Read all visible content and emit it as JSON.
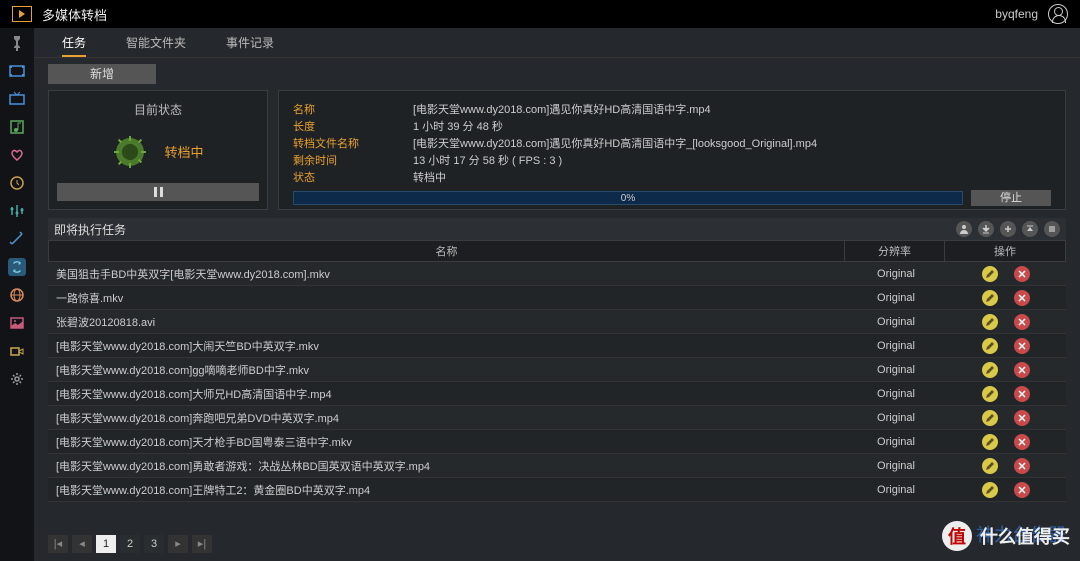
{
  "header": {
    "app_title": "多媒体转档",
    "username": "byqfeng"
  },
  "sidebar": {
    "icons": [
      "pin",
      "film",
      "tv",
      "music-lib",
      "heart",
      "clock",
      "equalizer",
      "wand",
      "recycle",
      "globe",
      "gallery",
      "camera",
      "settings"
    ],
    "active_index": 8
  },
  "tabs": {
    "items": [
      {
        "label": "任务",
        "active": true
      },
      {
        "label": "智能文件夹",
        "active": false
      },
      {
        "label": "事件记录",
        "active": false
      }
    ]
  },
  "buttons": {
    "new": "新增",
    "stop": "停止"
  },
  "status_panel": {
    "title": "目前状态",
    "status_text": "转档中"
  },
  "detail_panel": {
    "rows": [
      {
        "label": "名称",
        "value": "[电影天堂www.dy2018.com]遇见你真好HD高清国语中字.mp4"
      },
      {
        "label": "长度",
        "value": "1 小时 39 分 48 秒"
      },
      {
        "label": "转档文件名称",
        "value": "[电影天堂www.dy2018.com]遇见你真好HD高清国语中字_[looksgood_Original].mp4"
      },
      {
        "label": "剩余时间",
        "value": "13 小时 17 分 58 秒 ( FPS : 3 )"
      },
      {
        "label": "状态",
        "value": "转档中"
      }
    ],
    "progress_text": "0%"
  },
  "queue": {
    "title": "即将执行任务",
    "columns": {
      "name": "名称",
      "resolution": "分辨率",
      "operation": "操作"
    },
    "rows": [
      {
        "name": "美国狙击手BD中英双字[电影天堂www.dy2018.com].mkv",
        "res": "Original"
      },
      {
        "name": "一路惊喜.mkv",
        "res": "Original"
      },
      {
        "name": "张碧波20120818.avi",
        "res": "Original"
      },
      {
        "name": "[电影天堂www.dy2018.com]大闹天竺BD中英双字.mkv",
        "res": "Original"
      },
      {
        "name": "[电影天堂www.dy2018.com]gg嘀嘀老师BD中字.mkv",
        "res": "Original"
      },
      {
        "name": "[电影天堂www.dy2018.com]大师兄HD高清国语中字.mp4",
        "res": "Original"
      },
      {
        "name": "[电影天堂www.dy2018.com]奔跑吧兄弟DVD中英双字.mp4",
        "res": "Original"
      },
      {
        "name": "[电影天堂www.dy2018.com]天才枪手BD国粤泰三语中字.mkv",
        "res": "Original"
      },
      {
        "name": "[电影天堂www.dy2018.com]勇敢者游戏：决战丛林BD国英双语中英双字.mp4",
        "res": "Original"
      },
      {
        "name": "[电影天堂www.dy2018.com]王牌特工2：黄金圈BD中英双字.mp4",
        "res": "Original"
      }
    ]
  },
  "pagination": {
    "pages": [
      "1",
      "2",
      "3"
    ],
    "active": "1"
  },
  "watermark": {
    "badge_char": "值",
    "text": "什么值得买",
    "back_text": "神力台告器"
  }
}
